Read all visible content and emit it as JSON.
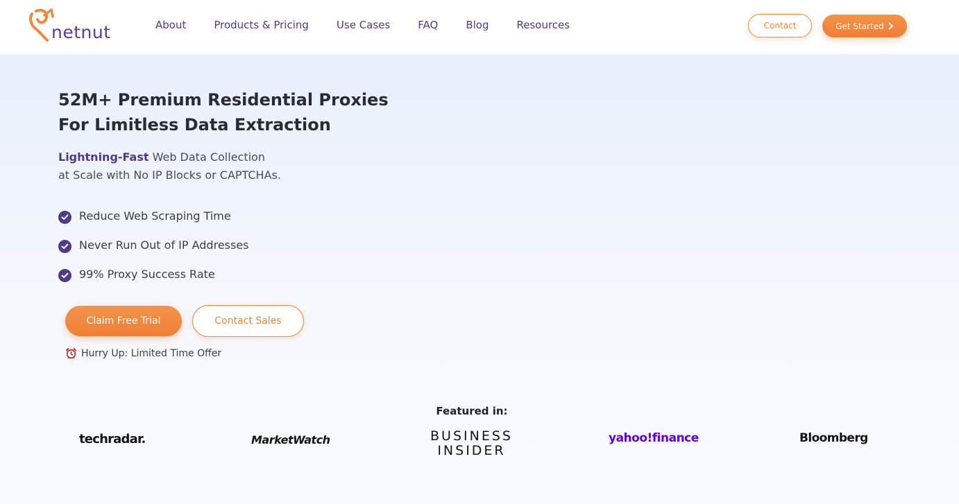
{
  "header": {
    "logo_text": "netnut",
    "nav": [
      "About",
      "Products & Pricing",
      "Use Cases",
      "FAQ",
      "Blog",
      "Resources"
    ],
    "contact_label": "Contact",
    "get_started_label": "Get Started"
  },
  "hero": {
    "title_line1": "52M+ Premium Residential Proxies",
    "title_line2": "For Limitless Data Extraction",
    "subtitle_highlight": "Lightning-Fast",
    "subtitle_rest": " Web Data Collection",
    "subtitle_line2": "at Scale with No IP Blocks or CAPTCHAs.",
    "features": [
      "Reduce Web Scraping Time",
      "Never Run Out of IP Addresses",
      "99% Proxy Success Rate"
    ],
    "trial_label": "Claim Free Trial",
    "sales_label": "Contact Sales",
    "hurry_text": "Hurry Up: Limited Time Offer"
  },
  "featured": {
    "label": "Featured in:",
    "logos": {
      "techradar": "techradar.",
      "marketwatch": "MarketWatch",
      "bi_line1": "BUSINESS",
      "bi_line2": "INSIDER",
      "yahoo": "yahoo!finance",
      "bloomberg": "Bloomberg"
    }
  },
  "colors": {
    "accent_orange": "#f0883e",
    "brand_purple": "#4f3a8a",
    "yahoo_purple": "#6001d2"
  },
  "icons": [
    "netnut-logo-icon",
    "chevron-right-icon",
    "check-circle-icon",
    "alarm-clock-icon"
  ]
}
